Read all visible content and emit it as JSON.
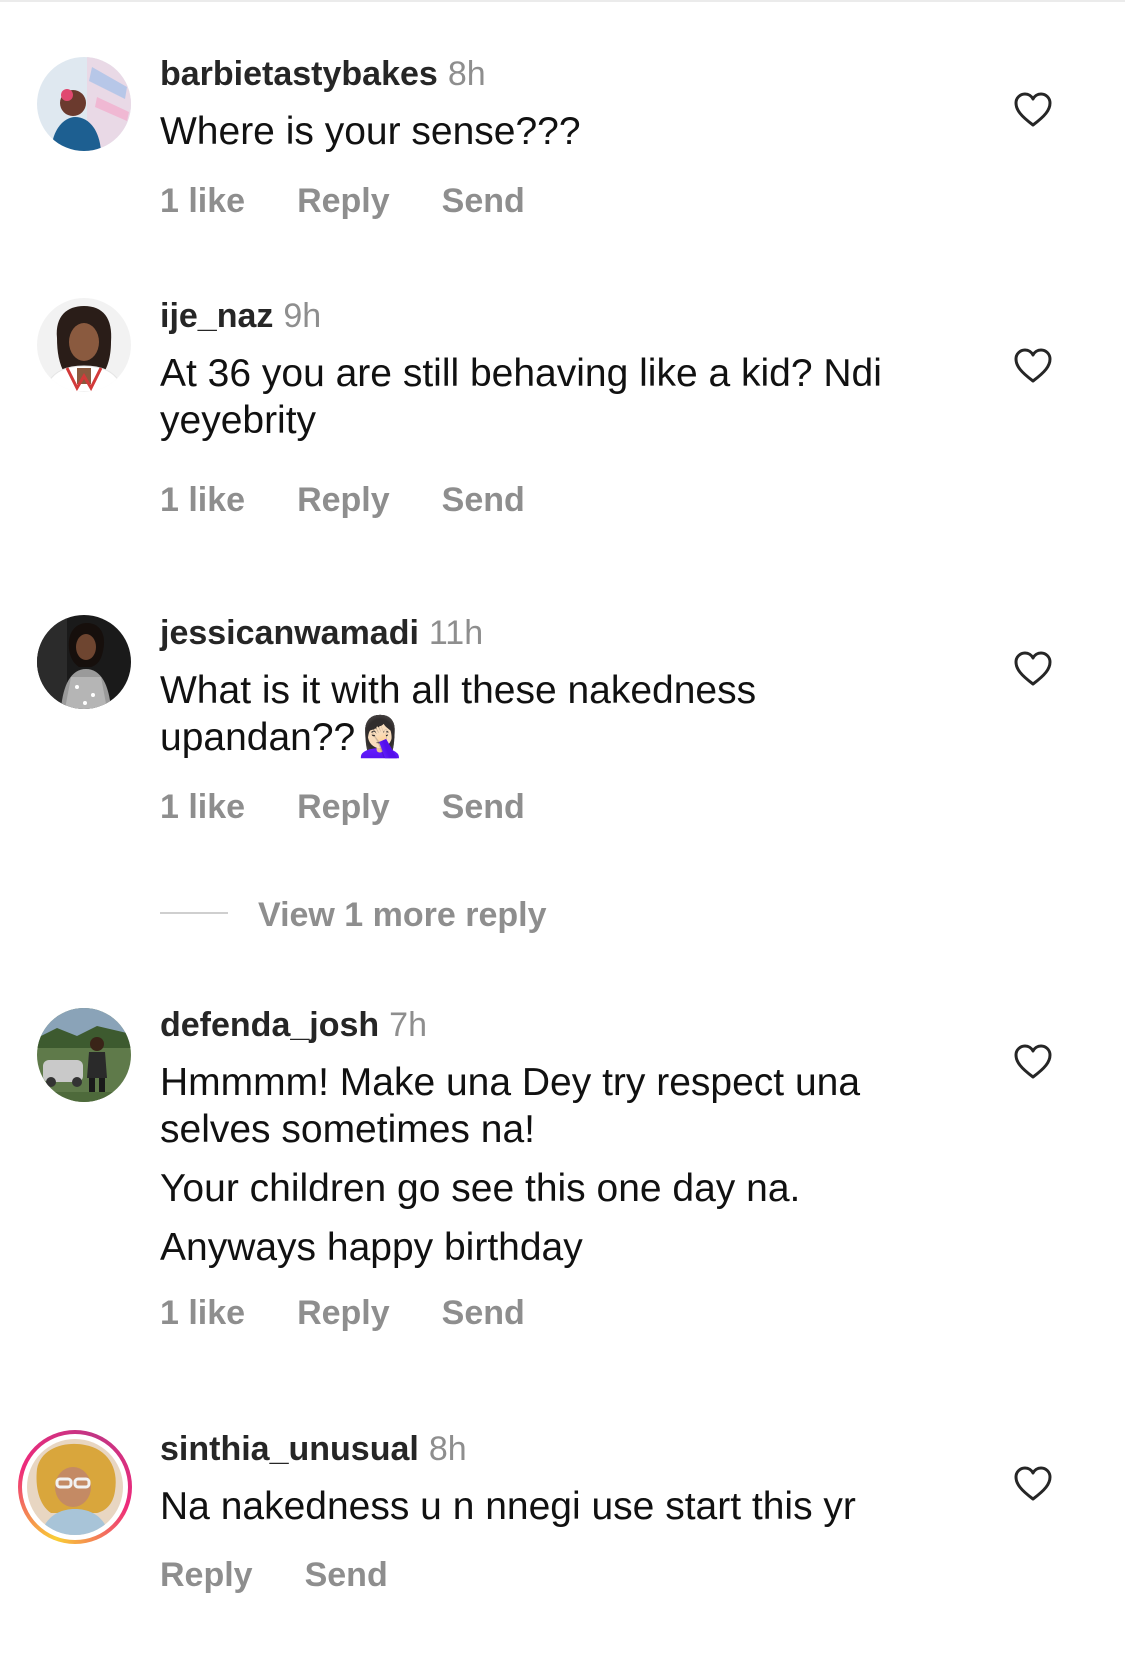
{
  "comments": [
    {
      "username": "barbietastybakes",
      "time": "8h",
      "text": [
        "Where is your sense???"
      ],
      "likes": "1 like",
      "reply": "Reply",
      "send": "Send",
      "avatar_icon": "avatar-photo"
    },
    {
      "username": "ije_naz",
      "time": "9h",
      "text": [
        "At 36 you are still behaving like a kid? Ndi yeyebrity"
      ],
      "likes": "1 like",
      "reply": "Reply",
      "send": "Send",
      "avatar_icon": "avatar-photo"
    },
    {
      "username": "jessicanwamadi",
      "time": "11h",
      "text": [
        "What is it with all these nakedness upandan??"
      ],
      "emoji": "🤦🏻‍♀️",
      "likes": "1 like",
      "reply": "Reply",
      "send": "Send",
      "avatar_icon": "avatar-photo"
    },
    {
      "username": "defenda_josh",
      "time": "7h",
      "text": [
        "Hmmmm! Make una Dey try respect una selves sometimes na!",
        "Your children go see this one day na.",
        "Anyways happy birthday"
      ],
      "likes": "1 like",
      "reply": "Reply",
      "send": "Send",
      "avatar_icon": "avatar-photo"
    },
    {
      "username": "sinthia_unusual",
      "time": "8h",
      "text": [
        "Na nakedness u n nnegi use start this yr"
      ],
      "reply": "Reply",
      "send": "Send",
      "avatar_icon": "avatar-photo-story-ring"
    }
  ],
  "view_more_reply": "View 1 more reply",
  "like_icon": "heart-outline-icon",
  "colors": {
    "text": "#111111",
    "muted": "#8e8e8e",
    "story_ring_start": "#f9ce34",
    "story_ring_end": "#c13584"
  }
}
